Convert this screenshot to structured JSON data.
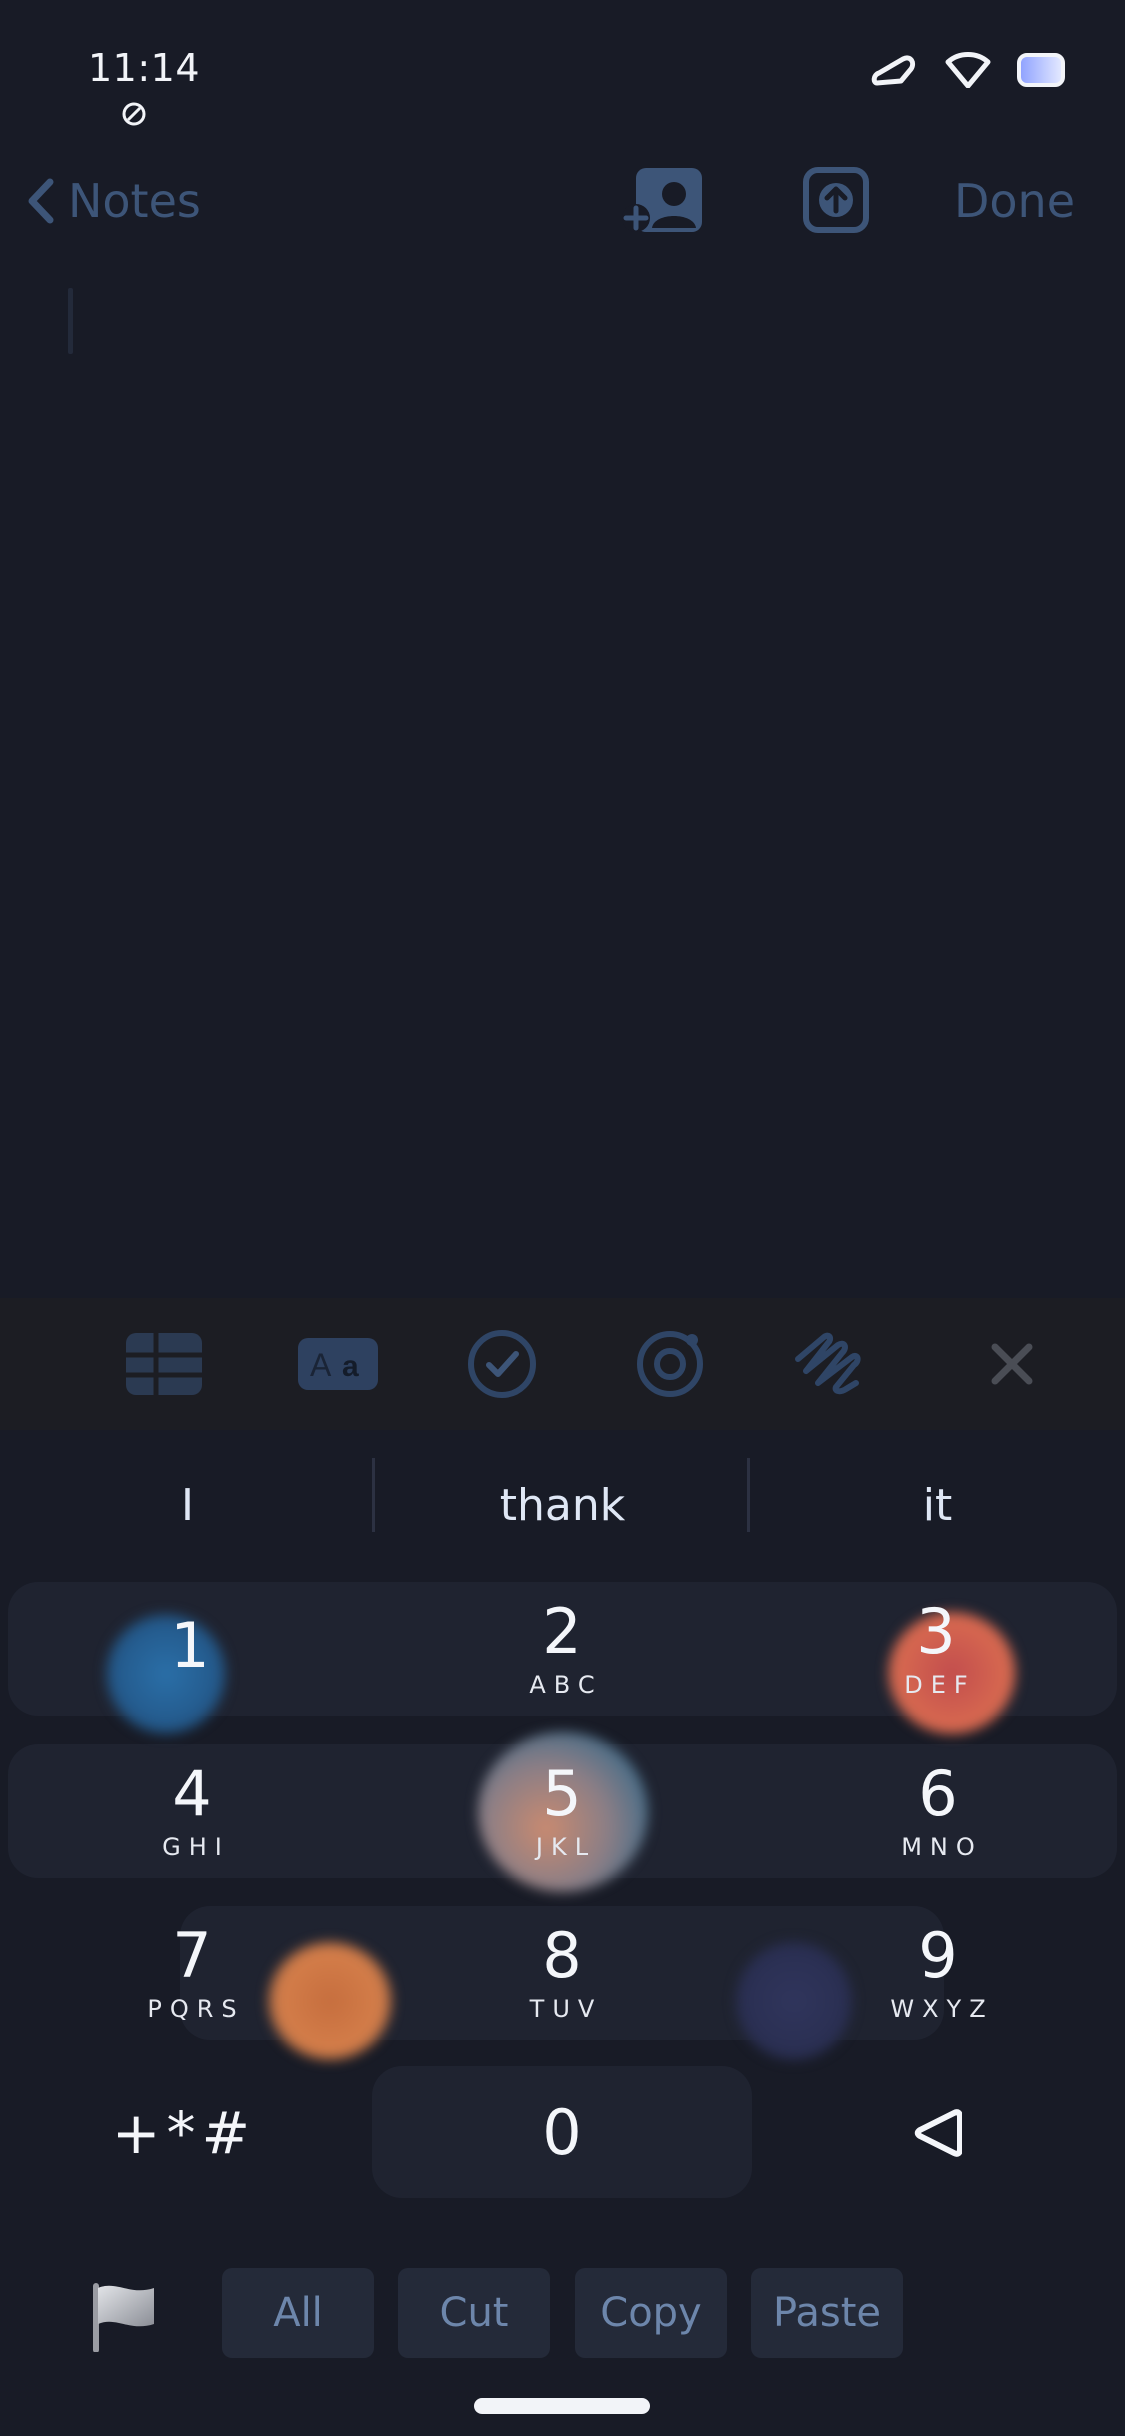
{
  "status": {
    "time": "11:14"
  },
  "nav": {
    "back_label": "Notes",
    "done_label": "Done"
  },
  "toolbar": {
    "format_glyph": "Aa"
  },
  "suggestions": [
    "I",
    "thank",
    "it"
  ],
  "keypad": {
    "keys": [
      {
        "digit": "1",
        "letters": ""
      },
      {
        "digit": "2",
        "letters": "ABC"
      },
      {
        "digit": "3",
        "letters": "DEF"
      },
      {
        "digit": "4",
        "letters": "GHI"
      },
      {
        "digit": "5",
        "letters": "JKL"
      },
      {
        "digit": "6",
        "letters": "MNO"
      },
      {
        "digit": "7",
        "letters": "PQRS"
      },
      {
        "digit": "8",
        "letters": "TUV"
      },
      {
        "digit": "9",
        "letters": "WXYZ"
      }
    ],
    "symbols": "+*#",
    "zero": "0"
  },
  "edit_actions": [
    "All",
    "Cut",
    "Copy",
    "Paste"
  ],
  "colors": {
    "background": "#181b26",
    "accent_dim": "#3d5578",
    "key_row": "#1f2330",
    "toolbar_bg": "#1c1d23",
    "action_text": "#6d86ab"
  },
  "icons": [
    "add-contact-icon",
    "share-icon",
    "table-icon",
    "format-text-icon",
    "checklist-icon",
    "camera-icon",
    "markup-icon",
    "close-icon",
    "backspace-icon",
    "flag-icon"
  ]
}
